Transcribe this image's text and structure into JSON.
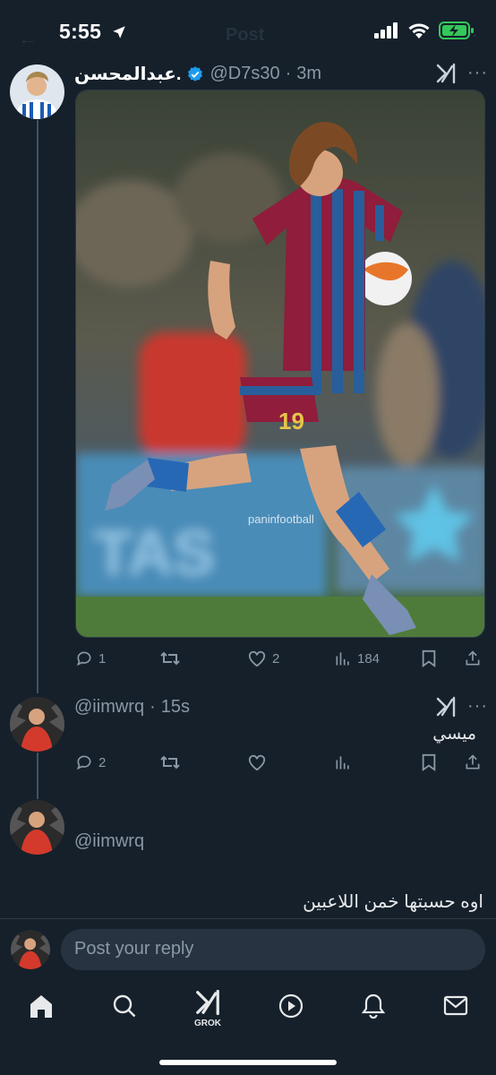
{
  "status_bar": {
    "time": "5:55",
    "battery_charging": true
  },
  "header": {
    "title": "Post"
  },
  "main_post": {
    "author_name": "عبدالمحسن.",
    "verified": true,
    "handle": "@D7s30",
    "separator": "·",
    "time": "3m",
    "media_watermark": "paninfootball",
    "shirt_number": "19",
    "stats": {
      "replies": "1",
      "reposts": "",
      "likes": "2",
      "views": "184"
    }
  },
  "reply_1": {
    "handle": "@iimwrq",
    "separator": "·",
    "time": "15s",
    "text": "ميسي",
    "stats": {
      "replies": "2",
      "reposts": "",
      "likes": "",
      "views": ""
    }
  },
  "reply_draft": {
    "handle": "@iimwrq",
    "text": "اوه حسبتها خمن اللاعبين"
  },
  "composer": {
    "placeholder": "Post your reply"
  },
  "tab_bar": {
    "items": [
      {
        "name": "home",
        "icon": "home-icon"
      },
      {
        "name": "search",
        "icon": "search-icon"
      },
      {
        "name": "grok",
        "icon": "grok-icon",
        "label": "GROK"
      },
      {
        "name": "video",
        "icon": "play-icon"
      },
      {
        "name": "notifications",
        "icon": "bell-icon"
      },
      {
        "name": "messages",
        "icon": "mail-icon"
      }
    ]
  },
  "colors": {
    "background": "#15202b",
    "verified": "#1d9bf0",
    "muted": "#8b98a5",
    "battery": "#34c759"
  }
}
